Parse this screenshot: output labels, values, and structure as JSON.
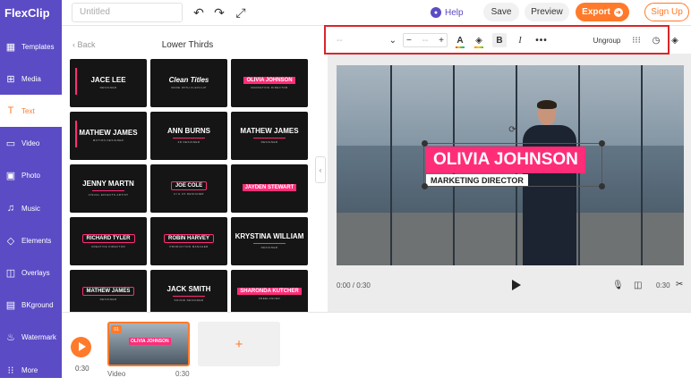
{
  "app": {
    "logo": "FlexClip",
    "project_title_placeholder": "Untitled"
  },
  "header": {
    "help": "Help",
    "save": "Save",
    "preview": "Preview",
    "export": "Export",
    "signup": "Sign Up"
  },
  "sidebar": {
    "items": [
      {
        "label": "Templates",
        "icon": "templates-icon",
        "glyph": "▦"
      },
      {
        "label": "Media",
        "icon": "media-icon",
        "glyph": "⊞"
      },
      {
        "label": "Text",
        "icon": "text-icon",
        "glyph": "T"
      },
      {
        "label": "Video",
        "icon": "video-icon",
        "glyph": "▭"
      },
      {
        "label": "Photo",
        "icon": "photo-icon",
        "glyph": "▣"
      },
      {
        "label": "Music",
        "icon": "music-icon",
        "glyph": "♫"
      },
      {
        "label": "Elements",
        "icon": "elements-icon",
        "glyph": "◇"
      },
      {
        "label": "Overlays",
        "icon": "overlays-icon",
        "glyph": "◫"
      },
      {
        "label": "BKground",
        "icon": "background-icon",
        "glyph": "▤"
      },
      {
        "label": "Watermark",
        "icon": "watermark-icon",
        "glyph": "♨"
      },
      {
        "label": "More",
        "icon": "more-icon",
        "glyph": "⁝⁝"
      }
    ],
    "active": "Text"
  },
  "panel": {
    "back": "Back",
    "title": "Lower Thirds",
    "thumbnails": [
      {
        "title": "JACE LEE",
        "subtitle": "DESIGNER"
      },
      {
        "title": "Clean Titles",
        "subtitle": "MADE WITH FLEXCLIP"
      },
      {
        "title": "OLIVIA JOHNSON",
        "subtitle": "MARKETING DIRECTOR"
      },
      {
        "title": "MATHEW JAMES",
        "subtitle": "MOTION DESIGNER"
      },
      {
        "title": "ANN BURNS",
        "subtitle": "3D DESIGNER"
      },
      {
        "title": "MATHEW JAMES",
        "subtitle": "DESIGNER"
      },
      {
        "title": "JENNY MARTN",
        "subtitle": "VISUAL EFFECTS ARTIST"
      },
      {
        "title": "JOE COLE",
        "subtitle": "UI & UX DESIGNER"
      },
      {
        "title": "JAYDEN STEWART",
        "subtitle": ""
      },
      {
        "title": "RICHARD TYLER",
        "subtitle": "CREATIVE DIRECTOR"
      },
      {
        "title": "ROBIN HARVEY",
        "subtitle": "PRODUCTION MANAGER"
      },
      {
        "title": "KRYSTINA WILLIAM",
        "subtitle": "DESIGNER"
      },
      {
        "title": "MATHEW JAMES",
        "subtitle": "DESIGNER"
      },
      {
        "title": "JACK SMITH",
        "subtitle": "SOUND DESIGNER"
      },
      {
        "title": "SHARONDA KUTCHER",
        "subtitle": "FREELANCER"
      }
    ]
  },
  "text_toolbar": {
    "font_value": "--",
    "size_value": "--",
    "ungroup": "Ungroup"
  },
  "canvas": {
    "lower_third_name": "OLIVIA JOHNSON",
    "lower_third_role": "MARKETING DIRECTOR"
  },
  "player": {
    "current_time": "0:00 / 0:30",
    "duration": "0:30"
  },
  "timeline": {
    "time": "0:30",
    "clip_number": "01",
    "clip_label": "Video",
    "clip_duration": "0:30",
    "clip_overlay_text": "OLIVIA JOHNSON",
    "add": "+"
  },
  "colors": {
    "brand": "#5b4bc4",
    "accent": "#ff7a2a",
    "pink": "#ff2d78",
    "highlight_border": "#d9262a"
  }
}
